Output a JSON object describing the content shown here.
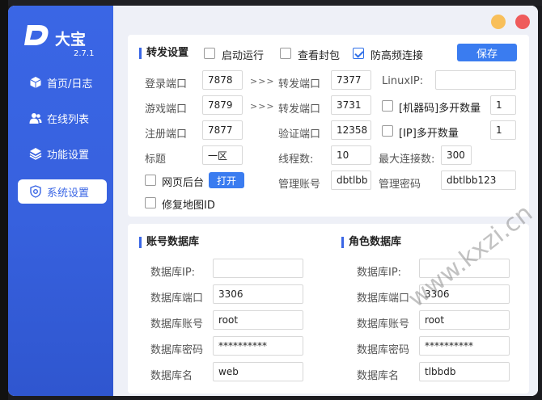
{
  "app": {
    "name": "大宝",
    "version": "2.7.1"
  },
  "window_controls": {
    "minimize": "minimize",
    "close": "close"
  },
  "sidebar": {
    "items": [
      {
        "label": "首页/日志",
        "icon": "cube-icon"
      },
      {
        "label": "在线列表",
        "icon": "users-icon"
      },
      {
        "label": "功能设置",
        "icon": "layers-icon"
      },
      {
        "label": "系统设置",
        "icon": "shield-gear-icon",
        "active": true
      }
    ]
  },
  "forward": {
    "title": "转发设置",
    "auto_start": {
      "label": "启动运行",
      "checked": false
    },
    "view_packet": {
      "label": "查看封包",
      "checked": false
    },
    "anti_freq": {
      "label": "防高频连接",
      "checked": true
    },
    "save_label": "保存",
    "login_port": {
      "label": "登录端口",
      "value": "7878"
    },
    "game_port": {
      "label": "游戏端口",
      "value": "7879"
    },
    "register_port": {
      "label": "注册端口",
      "value": "7877"
    },
    "title_field": {
      "label": "标题",
      "value": "一区"
    },
    "arrow": ">>>",
    "fwd_port_1": {
      "label": "转发端口",
      "value": "7377"
    },
    "fwd_port_2": {
      "label": "转发端口",
      "value": "3731"
    },
    "verify_port": {
      "label": "验证端口",
      "value": "12358"
    },
    "threads": {
      "label": "线程数:",
      "value": "10"
    },
    "linux_ip": {
      "label": "LinuxIP:",
      "value": ""
    },
    "machine_multi": {
      "label": "[机器码]多开数量",
      "value": "1",
      "checked": false
    },
    "ip_multi": {
      "label": "[IP]多开数量",
      "value": "1",
      "checked": false
    },
    "max_conn": {
      "label": "最大连接数:",
      "value": "300"
    },
    "web_backend": {
      "label": "网页后台",
      "checked": false,
      "open_label": "打开"
    },
    "admin_account": {
      "label": "管理账号",
      "value": "dbtlbb"
    },
    "admin_password": {
      "label": "管理密码",
      "value": "dbtlbb123"
    },
    "fix_map": {
      "label": "修复地图ID",
      "checked": false
    }
  },
  "account_db": {
    "title": "账号数据库",
    "ip": {
      "label": "数据库IP:",
      "value": ""
    },
    "port": {
      "label": "数据库端口",
      "value": "3306"
    },
    "user": {
      "label": "数据库账号",
      "value": "root"
    },
    "password": {
      "label": "数据库密码",
      "value": "**********"
    },
    "name": {
      "label": "数据库名",
      "value": "web"
    }
  },
  "role_db": {
    "title": "角色数据库",
    "ip": {
      "label": "数据库IP:",
      "value": ""
    },
    "port": {
      "label": "数据库端口",
      "value": "3306"
    },
    "user": {
      "label": "数据库账号",
      "value": "root"
    },
    "password": {
      "label": "数据库密码",
      "value": "**********"
    },
    "name": {
      "label": "数据库名",
      "value": "tlbbdb"
    }
  },
  "watermark": "www.kxzi.cn",
  "colors": {
    "accent": "#3a66e5",
    "button": "#3a7cf0",
    "minimize": "#f8bf5a",
    "close": "#ef5b5b"
  }
}
